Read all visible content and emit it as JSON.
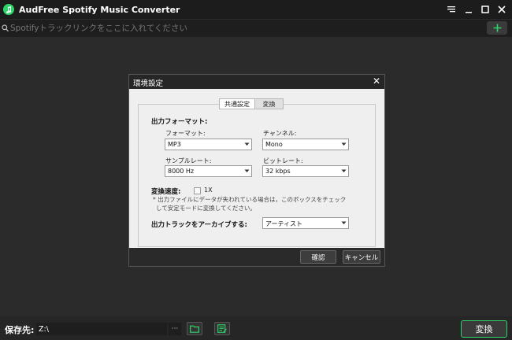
{
  "app": {
    "title": "AudFree Spotify Music Converter"
  },
  "search": {
    "placeholder": "Spotifyトラックリンクをここに入れてください"
  },
  "bottom": {
    "save_label": "保存先:",
    "path_value": "Z:\\",
    "browse_label": "···",
    "convert_label": "変換"
  },
  "dialog": {
    "title": "環境設定",
    "close_label": "✕",
    "tabs": [
      {
        "label": "共通設定",
        "active": true
      },
      {
        "label": "変換",
        "active": false
      }
    ],
    "output_format_heading": "出力フォーマット:",
    "format": {
      "label": "フォーマット:",
      "value": "MP3"
    },
    "channel": {
      "label": "チャンネル:",
      "value": "Mono"
    },
    "sample_rate": {
      "label": "サンプルレート:",
      "value": "8000 Hz"
    },
    "bit_rate": {
      "label": "ビットレート:",
      "value": "32 kbps"
    },
    "speed": {
      "label": "変換速度:",
      "checkbox_label": "1X",
      "checked": false
    },
    "note_line1": "* 出力ファイルにデータが失われている場合は，このボックスをチェック",
    "note_line2": "して安定モードに変換してください。",
    "archive": {
      "label": "出力トラックをアーカイブする:",
      "value": "アーティスト"
    },
    "ok_label": "確認",
    "cancel_label": "キャンセル"
  },
  "colors": {
    "accent": "#2fd46b",
    "panel": "#efefef",
    "background": "#2b2b2b"
  }
}
